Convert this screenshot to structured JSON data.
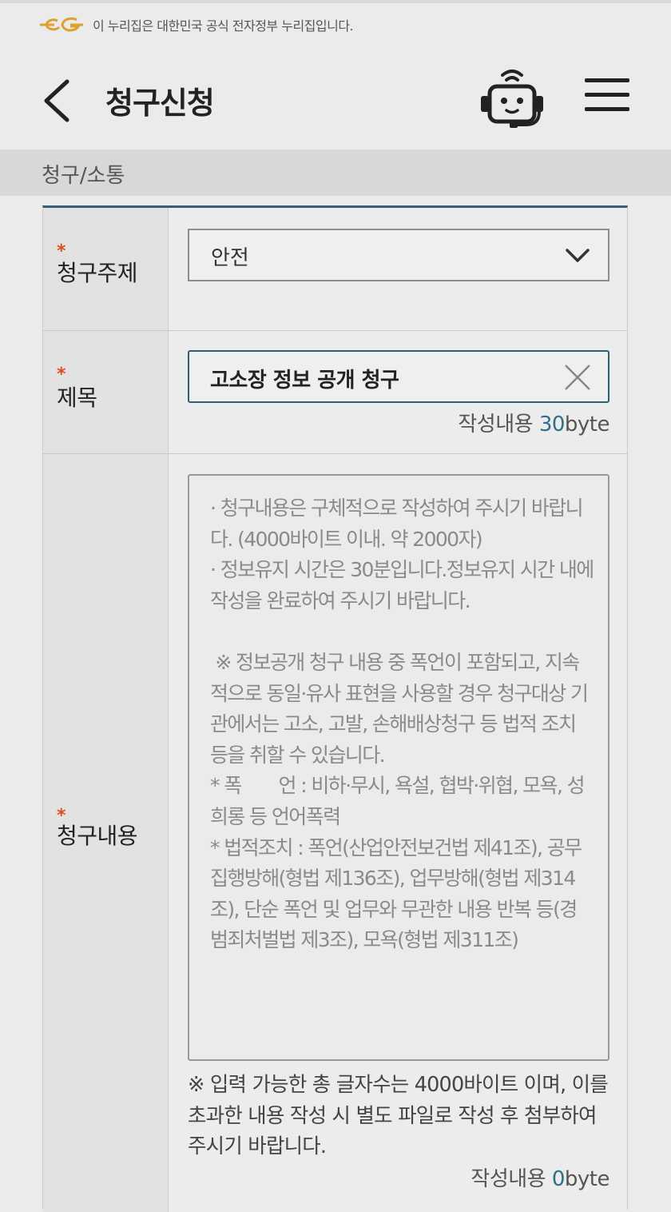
{
  "gov_banner": {
    "text": "이 누리집은 대한민국 공식 전자정부 누리집입니다."
  },
  "header": {
    "title": "청구신청",
    "back_icon": "chevron-left-icon",
    "chatbot_icon": "chatbot-headset-icon",
    "menu_icon": "hamburger-menu-icon"
  },
  "breadcrumb": "청구/소통",
  "form": {
    "required_mark": "*",
    "subject": {
      "label": "청구주제",
      "selected": "안전"
    },
    "title": {
      "label": "제목",
      "value": "고소장 정보 공개 청구",
      "counter_prefix": "작성내용 ",
      "counter_value": "30",
      "counter_unit": "byte"
    },
    "content": {
      "label": "청구내용",
      "placeholder": "· 청구내용은 구체적으로 작성하여 주시기 바랍니다. (4000바이트 이내. 약 2000자)\n· 정보유지 시간은 30분입니다.정보유지 시간 내에 작성을 완료하여 주시기 바랍니다.\n\n ※ 정보공개 청구 내용 중 폭언이 포함되고, 지속적으로 동일·유사 표현을 사용할 경우 청구대상 기관에서는 고소, 고발, 손해배상청구 등 법적 조치 등을 취할 수 있습니다.\n* 폭　　언 : 비하·무시, 욕설, 협박·위협, 모욕, 성희롱 등 언어폭력\n* 법적조치 : 폭언(산업안전보건법 제41조), 공무집행방해(형법 제136조), 업무방해(형법 제314조), 단순 폭언 및 업무와 무관한 내용 반복 등(경범죄처벌법 제3조), 모욕(형법 제311조)",
      "note": "※ 입력 가능한 총 글자수는 4000바이트 이며, 이를 초과한 내용 작성 시 별도 파일로 작성 후 첨부하여 주시기 바랍니다.",
      "counter_prefix": "작성내용 ",
      "counter_value": "0",
      "counter_unit": "byte"
    }
  },
  "colors": {
    "accent": "#2f5f72",
    "required": "#d9501f",
    "logo": "#e0a030"
  }
}
